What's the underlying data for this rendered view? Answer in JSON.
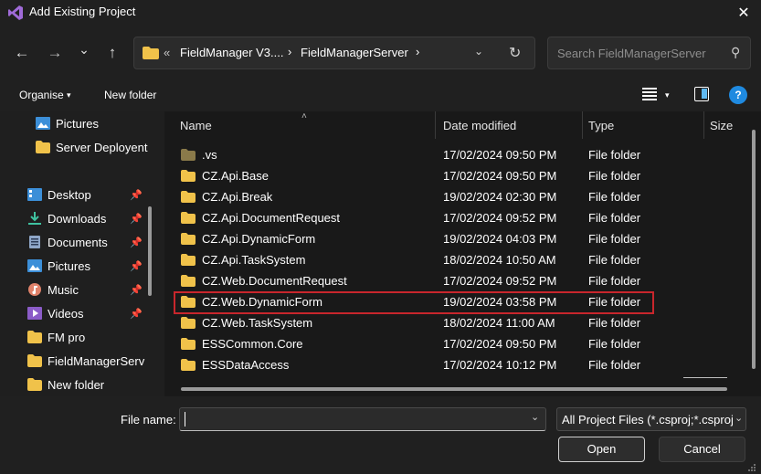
{
  "window": {
    "title": "Add Existing Project",
    "close_glyph": "✕"
  },
  "nav": {
    "back_glyph": "←",
    "forward_glyph": "→",
    "recent_glyph": "⌄",
    "up_glyph": "↑"
  },
  "address": {
    "overflow": "«",
    "crumbs": [
      "FieldManager V3....",
      "FieldManagerServer"
    ],
    "separator": "›",
    "dropdown_glyph": "⌄",
    "refresh_glyph": "↻"
  },
  "search": {
    "placeholder": "Search FieldManagerServer",
    "icon_glyph": "⚲"
  },
  "toolbar": {
    "organise": "Organise",
    "new_folder": "New folder",
    "dropdown_glyph": "▾",
    "help_glyph": "?"
  },
  "sidebar": {
    "items": [
      {
        "label": "Pictures",
        "icon": "pictures-icon"
      },
      {
        "label": "Server Deployent",
        "icon": "folder-icon"
      },
      {
        "label": "Desktop",
        "icon": "desktop-icon",
        "pinned": true
      },
      {
        "label": "Downloads",
        "icon": "downloads-icon",
        "pinned": true
      },
      {
        "label": "Documents",
        "icon": "documents-icon",
        "pinned": true
      },
      {
        "label": "Pictures",
        "icon": "pictures-icon",
        "pinned": true
      },
      {
        "label": "Music",
        "icon": "music-icon",
        "pinned": true
      },
      {
        "label": "Videos",
        "icon": "videos-icon",
        "pinned": true
      },
      {
        "label": "FM pro",
        "icon": "folder-icon"
      },
      {
        "label": "FieldManagerServ",
        "icon": "folder-icon"
      },
      {
        "label": "New folder",
        "icon": "folder-icon"
      }
    ],
    "pin_glyph": "📌"
  },
  "file_list": {
    "columns": {
      "name": "Name",
      "date": "Date modified",
      "type": "Type",
      "size": "Size"
    },
    "sort_glyph": "˄",
    "rows": [
      {
        "name": ".vs",
        "date": "17/02/2024 09:50 PM",
        "type": "File folder",
        "hidden": true
      },
      {
        "name": "CZ.Api.Base",
        "date": "17/02/2024 09:50 PM",
        "type": "File folder"
      },
      {
        "name": "CZ.Api.Break",
        "date": "19/02/2024 02:30 PM",
        "type": "File folder"
      },
      {
        "name": "CZ.Api.DocumentRequest",
        "date": "17/02/2024 09:52 PM",
        "type": "File folder"
      },
      {
        "name": "CZ.Api.DynamicForm",
        "date": "19/02/2024 04:03 PM",
        "type": "File folder"
      },
      {
        "name": "CZ.Api.TaskSystem",
        "date": "18/02/2024 10:50 AM",
        "type": "File folder"
      },
      {
        "name": "CZ.Web.DocumentRequest",
        "date": "17/02/2024 09:52 PM",
        "type": "File folder"
      },
      {
        "name": "CZ.Web.DynamicForm",
        "date": "19/02/2024 03:58 PM",
        "type": "File folder",
        "highlighted": true
      },
      {
        "name": "CZ.Web.TaskSystem",
        "date": "18/02/2024 11:00 AM",
        "type": "File folder"
      },
      {
        "name": "ESSCommon.Core",
        "date": "17/02/2024 09:50 PM",
        "type": "File folder"
      },
      {
        "name": "ESSDataAccess",
        "date": "17/02/2024 10:12 PM",
        "type": "File folder"
      }
    ]
  },
  "footer": {
    "file_name_label": "File name:",
    "file_name_value": "",
    "dropdown_glyph": "⌄",
    "filter": "All Project Files (*.csproj;*.csproj",
    "open": "Open",
    "cancel": "Cancel"
  },
  "colors": {
    "folder": "#f0c24a",
    "folder_hidden": "#8a7a4a",
    "highlight": "#c8262c",
    "accent": "#1f8ae0"
  }
}
